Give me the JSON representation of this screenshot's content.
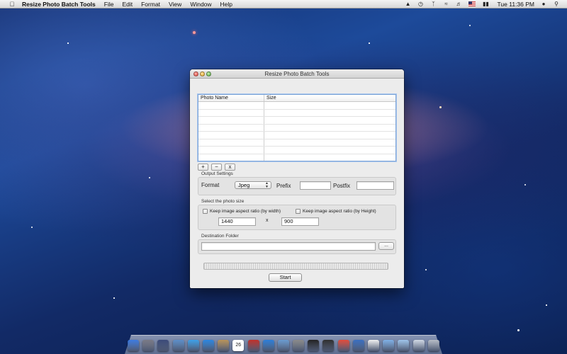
{
  "menubar": {
    "apple_icon": "apple-icon",
    "app_name": "Resize Photo Batch Tools",
    "items": [
      "File",
      "Edit",
      "Format",
      "View",
      "Window",
      "Help"
    ],
    "status_icons": [
      "notification-icon",
      "time-machine-icon",
      "bluetooth-icon",
      "wifi-icon",
      "volume-icon",
      "us-flag-icon",
      "battery-icon"
    ],
    "clock": "Tue 11:36 PM",
    "user_icon": "user-icon",
    "search_icon": "spotlight-icon"
  },
  "window": {
    "title": "Resize Photo Batch Tools",
    "table": {
      "columns": [
        "Photo Name",
        "Size"
      ],
      "rows": []
    },
    "list_buttons": [
      "+",
      "−",
      "x"
    ],
    "output_settings": {
      "group_label": "Output Settings",
      "format_label": "Format",
      "format_value": "Jpeg",
      "prefix_label": "Prefix",
      "prefix_value": "",
      "postfix_label": "Postfix",
      "postfix_value": ""
    },
    "photo_size": {
      "group_label": "Select the photo size",
      "keep_width_label": "Keep image aspect ratio (by width)",
      "keep_width_checked": false,
      "keep_height_label": "Keep image aspect ratio (by Height)",
      "keep_height_checked": false,
      "width_value": "1440",
      "separator": "x",
      "height_value": "900"
    },
    "destination": {
      "group_label": "Destination Folder",
      "path_value": "",
      "browse_label": "..."
    },
    "progress": 0,
    "start_label": "Start"
  },
  "dock": {
    "items": [
      "finder-icon",
      "launchpad-icon",
      "mission-control-icon",
      "preview-icon",
      "safari-icon",
      "app-store-icon",
      "contacts-icon",
      "calendar-icon",
      "photo-booth-icon",
      "itunes-icon",
      "iphoto-icon",
      "system-preferences-icon",
      "terminal-icon",
      "activity-monitor-icon",
      "chrome-icon",
      "xcode-icon",
      "textedit-icon",
      "downloads-icon",
      "documents-icon",
      "mail-icon",
      "trash-icon"
    ],
    "calendar_day": "26"
  }
}
